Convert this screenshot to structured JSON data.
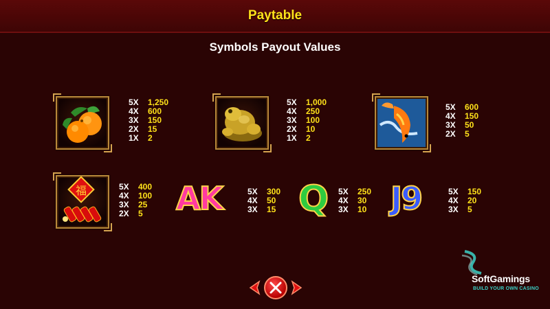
{
  "header": {
    "title": "Paytable"
  },
  "subtitle": "Symbols Payout Values",
  "symbols": [
    {
      "icon": "oranges-icon",
      "pays": [
        {
          "mult": "5X",
          "value": "1,250"
        },
        {
          "mult": "4X",
          "value": "600"
        },
        {
          "mult": "3X",
          "value": "150"
        },
        {
          "mult": "2X",
          "value": "15"
        },
        {
          "mult": "1X",
          "value": "2"
        }
      ]
    },
    {
      "icon": "golden-toad-icon",
      "pays": [
        {
          "mult": "5X",
          "value": "1,000"
        },
        {
          "mult": "4X",
          "value": "250"
        },
        {
          "mult": "3X",
          "value": "100"
        },
        {
          "mult": "2X",
          "value": "10"
        },
        {
          "mult": "1X",
          "value": "2"
        }
      ]
    },
    {
      "icon": "koi-fish-icon",
      "pays": [
        {
          "mult": "5X",
          "value": "600"
        },
        {
          "mult": "4X",
          "value": "150"
        },
        {
          "mult": "3X",
          "value": "50"
        },
        {
          "mult": "2X",
          "value": "5"
        }
      ]
    },
    {
      "icon": "firecrackers-icon",
      "pays": [
        {
          "mult": "5X",
          "value": "400"
        },
        {
          "mult": "4X",
          "value": "100"
        },
        {
          "mult": "3X",
          "value": "25"
        },
        {
          "mult": "2X",
          "value": "5"
        }
      ]
    },
    {
      "icon": "ak-symbol-icon",
      "pays": [
        {
          "mult": "5X",
          "value": "300"
        },
        {
          "mult": "4X",
          "value": "50"
        },
        {
          "mult": "3X",
          "value": "15"
        }
      ]
    },
    {
      "icon": "q-symbol-icon",
      "pays": [
        {
          "mult": "5X",
          "value": "250"
        },
        {
          "mult": "4X",
          "value": "30"
        },
        {
          "mult": "3X",
          "value": "10"
        }
      ]
    },
    {
      "icon": "j9-symbol-icon",
      "pays": [
        {
          "mult": "5X",
          "value": "150"
        },
        {
          "mult": "4X",
          "value": "20"
        },
        {
          "mult": "3X",
          "value": "5"
        }
      ]
    }
  ],
  "firecracker_glyph": "福",
  "letters": {
    "ak": "AK",
    "q": "Q",
    "j9": "J9"
  },
  "logo": {
    "name": "SoftGamings",
    "tagline": "BUILD YOUR OWN CASINO"
  },
  "colors": {
    "background": "#2a0404",
    "header": "#4a0606",
    "title": "#ffe21a",
    "value": "#ffe21a",
    "multiplier": "#ffffff",
    "accent_teal": "#3bd1c7"
  }
}
